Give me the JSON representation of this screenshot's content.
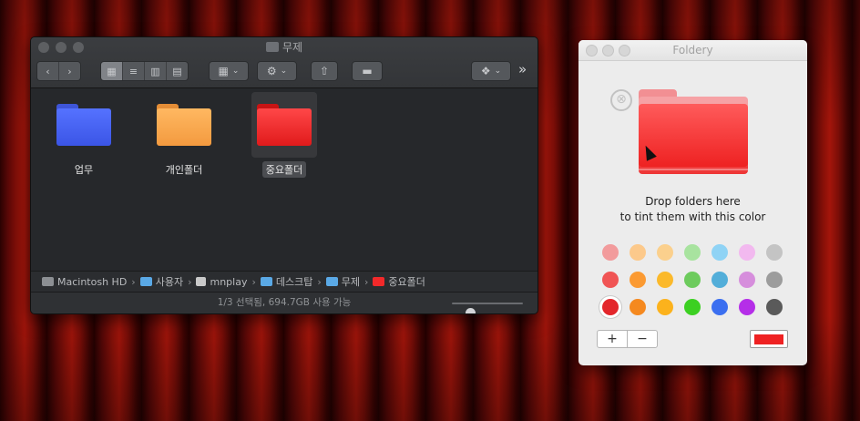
{
  "finder": {
    "title": "무제",
    "files": [
      {
        "label": "업무",
        "color": "#3f5df0",
        "color_dark": "#2f46c9",
        "selected": false
      },
      {
        "label": "개인폴더",
        "color": "#fba64e",
        "color_dark": "#e48d36",
        "selected": false
      },
      {
        "label": "중요폴더",
        "color": "#f2292a",
        "color_dark": "#c81414",
        "selected": true
      }
    ],
    "path": [
      {
        "label": "Macintosh HD",
        "icon": "hard-drive-icon"
      },
      {
        "label": "사용자",
        "icon": "folder-icon"
      },
      {
        "label": "mnplay",
        "icon": "home-icon"
      },
      {
        "label": "데스크탑",
        "icon": "folder-icon"
      },
      {
        "label": "무제",
        "icon": "folder-icon"
      },
      {
        "label": "중요폴더",
        "icon": "red-folder-icon"
      }
    ],
    "path_separator": "›",
    "status": "1/3 선택됨, 694.7GB 사용 가능",
    "icon_size_slider": 0.25,
    "toolbar": {
      "back": "‹",
      "forward": "›",
      "view_icons": "▦",
      "view_list": "≡",
      "view_columns": "▥",
      "view_gallery": "▤",
      "group": "▦",
      "action": "⚙",
      "share": "⇧",
      "tag": "▬",
      "dropbox": "❖",
      "more": "»",
      "dropdown": "⌄"
    }
  },
  "foldery": {
    "title": "Foldery",
    "clear_icon": "⊗",
    "drop_line1": "Drop folders here",
    "drop_line2": "to tint them with this color",
    "swatches": [
      [
        "#f29b9c",
        "#fcc98b",
        "#fbd08d",
        "#a8e39f",
        "#8fd3f5",
        "#f2b9ef",
        "#c4c4c4"
      ],
      [
        "#f05454",
        "#fb9a32",
        "#fbb92b",
        "#6dcb5d",
        "#53aed9",
        "#d68edc",
        "#9c9c9c"
      ],
      [
        "#e3262b",
        "#f5891f",
        "#fcb21c",
        "#3cd022",
        "#3b6ff0",
        "#b52ee8",
        "#5a5a5a"
      ]
    ],
    "selected_swatch": [
      2,
      0
    ],
    "plus": "+",
    "minus": "−",
    "current_color": "#ef2122"
  }
}
